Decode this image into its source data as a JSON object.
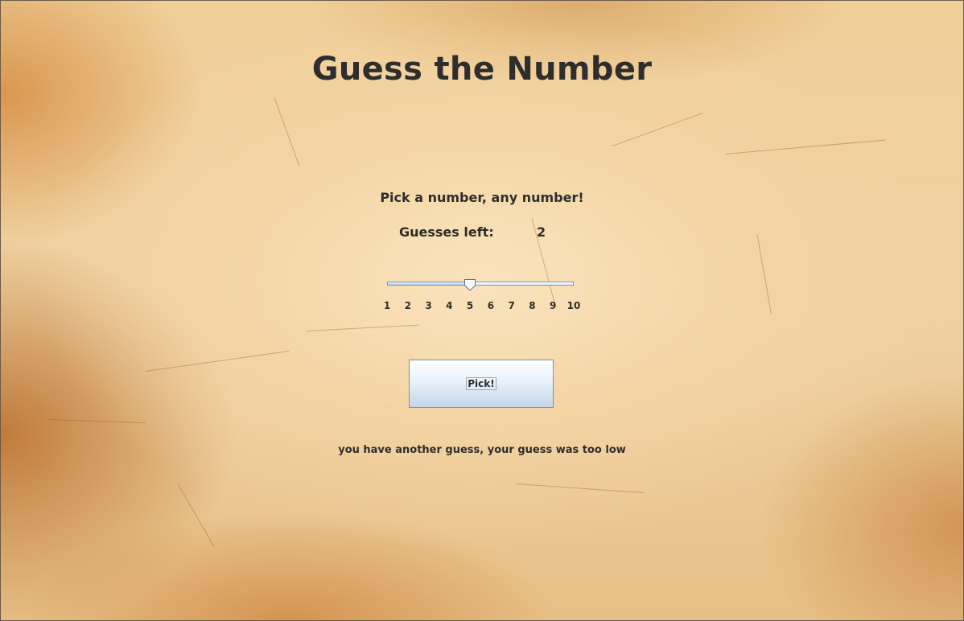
{
  "game": {
    "title": "Guess the Number",
    "prompt": "Pick a number, any number!",
    "guesses_left_label": "Guesses left:",
    "guesses_left_value": "2",
    "slider": {
      "min": 1,
      "max": 10,
      "value": 5,
      "ticks": [
        "1",
        "2",
        "3",
        "4",
        "5",
        "6",
        "7",
        "8",
        "9",
        "10"
      ]
    },
    "pick_button_label": "Pick!",
    "status_message": "you have another guess, your guess was too low"
  },
  "colors": {
    "text": "#2e2e2e",
    "parchment": "#efd1a1",
    "button_border": "#7a8ea6",
    "slider_track_border": "#7e96b0"
  },
  "icons": {
    "slider_thumb": "pentagon-thumb-icon"
  }
}
